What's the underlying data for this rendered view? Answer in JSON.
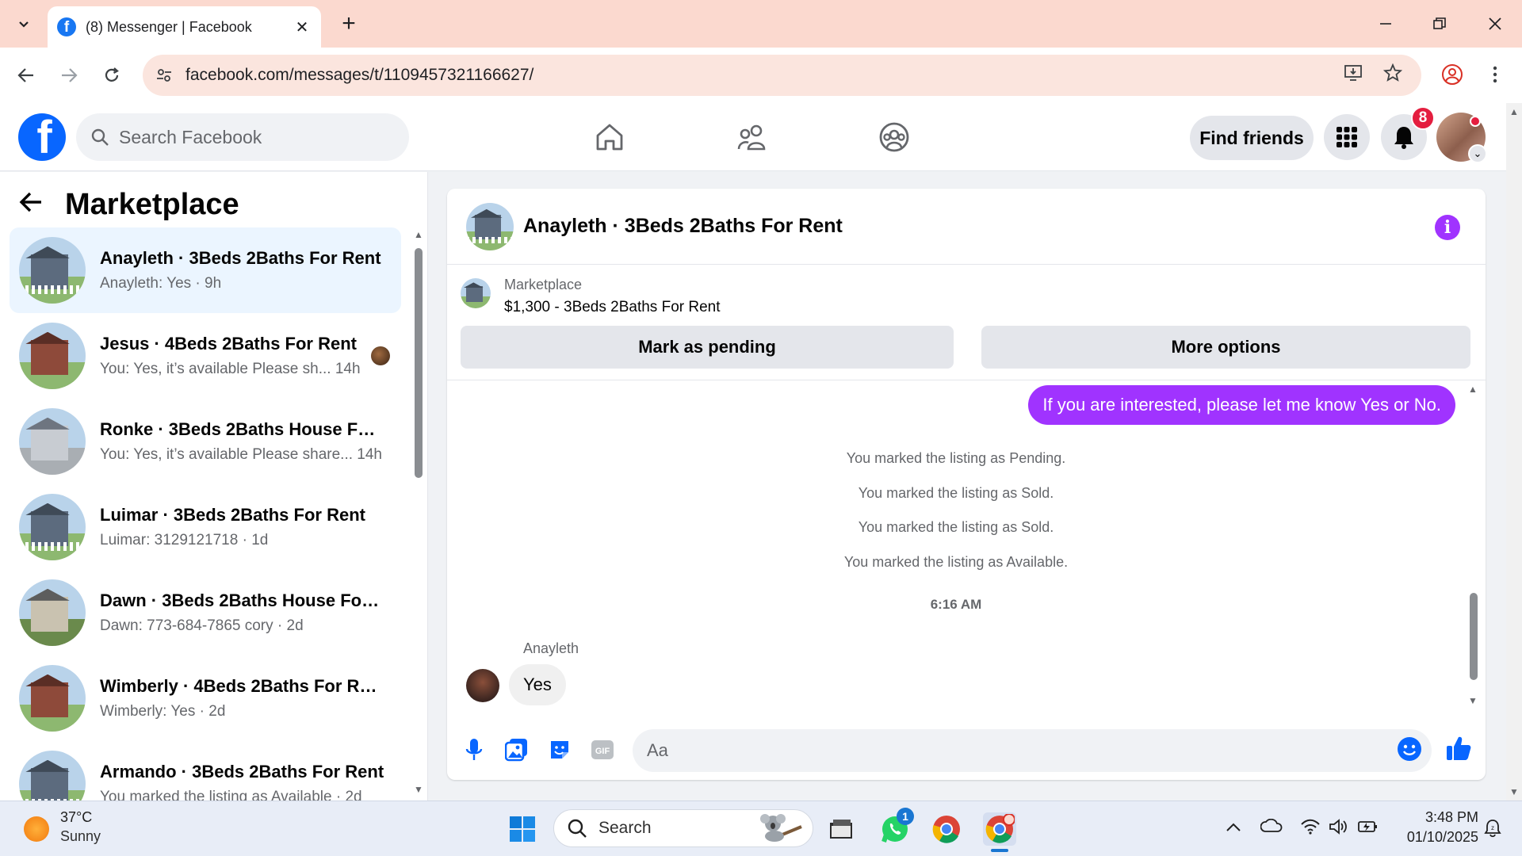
{
  "browser": {
    "tab_title": "(8) Messenger | Facebook",
    "url": "facebook.com/messages/t/1109457321166627/"
  },
  "fb_header": {
    "search_placeholder": "Search Facebook",
    "find_friends_label": "Find friends",
    "notification_count": "8"
  },
  "left_panel": {
    "title": "Marketplace",
    "conversations": [
      {
        "title": "Anayleth · 3Beds 2Baths For Rent",
        "preview": "Anayleth: Yes · 9h",
        "active": true
      },
      {
        "title": "Jesus · 4Beds 2Baths For Rent",
        "preview": "You: Yes, it’s available Please sh...  14h",
        "active": false
      },
      {
        "title": "Ronke · 3Beds 2Baths House For...",
        "preview": "You: Yes, it’s available Please share...  14h",
        "active": false
      },
      {
        "title": "Luimar · 3Beds 2Baths For Rent",
        "preview": "Luimar: 3129121718 · 1d",
        "active": false
      },
      {
        "title": "Dawn · 3Beds 2Baths House For ...",
        "preview": "Dawn: 773-684-7865 cory · 2d",
        "active": false
      },
      {
        "title": "Wimberly · 4Beds 2Baths For Rent",
        "preview": "Wimberly: Yes · 2d",
        "active": false
      },
      {
        "title": "Armando · 3Beds 2Baths For Rent",
        "preview": "You marked the listing as Available · 2d",
        "active": false
      }
    ]
  },
  "chat": {
    "title": "Anayleth · 3Beds 2Baths For Rent",
    "listing_label": "Marketplace",
    "listing_price": "$1,300 - 3Beds 2Baths For Rent",
    "mark_pending_label": "Mark as pending",
    "more_options_label": "More options",
    "outgoing_message": "If you are interested, please let me know Yes or No.",
    "system_messages": [
      "You marked the listing as Pending.",
      "You marked the listing as Sold.",
      "You marked the listing as Sold.",
      "You marked the listing as Available."
    ],
    "timestamp": "6:16 AM",
    "sender_name": "Anayleth",
    "incoming_message": "Yes",
    "composer_placeholder": "Aa"
  },
  "taskbar": {
    "weather_temp": "37°C",
    "weather_desc": "Sunny",
    "search_label": "Search",
    "whatsapp_badge": "1",
    "time": "3:48 PM",
    "date": "01/10/2025"
  },
  "colors": {
    "fb_blue": "#0866ff",
    "messenger_purple": "#a033ff",
    "tabbar_bg": "#fbd9cf"
  }
}
